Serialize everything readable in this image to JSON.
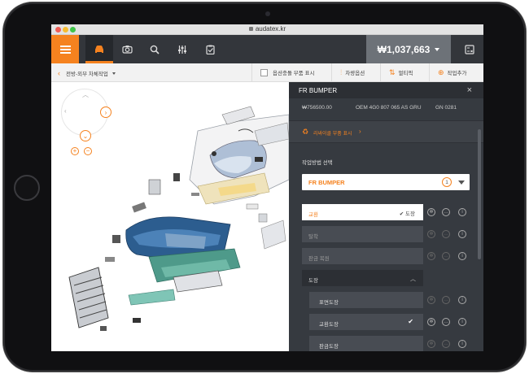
{
  "browser": {
    "url": "audatex.kr"
  },
  "appbar": {
    "total_price": "₩1,037,663"
  },
  "subbar": {
    "breadcrumb": "전방-외부 차체작업",
    "show_option_parts": "옵션충돌 부품 표시",
    "vehicle_options": "차량옵션",
    "multi": "멀티픽",
    "add_job": "작업추가"
  },
  "canvas": {
    "zoom_in": "+",
    "zoom_out": "−"
  },
  "panel": {
    "title": "FR BUMPER",
    "price": "₩756500.00",
    "oem": "OEM 4G0 807 065 AS GRU",
    "gn": "GN 0281",
    "recycle_label": "리싸이클 부품 표시",
    "method_label": "작업방법 선택",
    "selected_part": "FR BUMPER",
    "selected_count": "1",
    "operations": [
      {
        "label": "교환",
        "tag": "✔ 도장"
      },
      {
        "label": "탈착"
      },
      {
        "label": "판금 복원"
      },
      {
        "label": "도장"
      }
    ],
    "paint_sub": [
      {
        "label": "표면도장"
      },
      {
        "label": "교환도장",
        "check": "✔"
      },
      {
        "label": "판금도장"
      }
    ]
  },
  "colors": {
    "accent": "#f5821f",
    "appbar": "#33363b",
    "panel": "#363a40"
  }
}
